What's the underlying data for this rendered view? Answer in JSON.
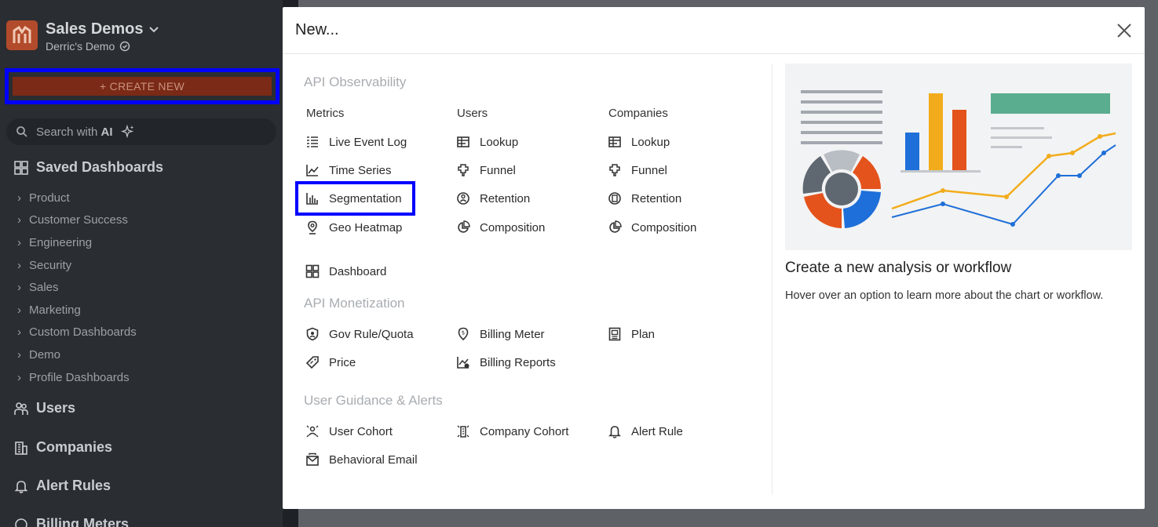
{
  "sidebar": {
    "org_name": "Sales Demos",
    "org_sub": "Derric's Demo",
    "create_label": "+ CREATE NEW",
    "search_label": "Search with",
    "search_ai": "AI",
    "saved_dashboards": "Saved Dashboards",
    "dashboards": [
      "Product",
      "Customer Success",
      "Engineering",
      "Security",
      "Sales",
      "Marketing",
      "Custom Dashboards",
      "Demo",
      "Profile Dashboards"
    ],
    "users": "Users",
    "companies": "Companies",
    "alert_rules": "Alert Rules",
    "billing_meters": "Billing Meters"
  },
  "modal": {
    "title": "New...",
    "api_observability": "API Observability",
    "col_metrics": "Metrics",
    "col_users": "Users",
    "col_companies": "Companies",
    "metrics": [
      "Live Event Log",
      "Time Series",
      "Segmentation",
      "Geo Heatmap"
    ],
    "users": [
      "Lookup",
      "Funnel",
      "Retention",
      "Composition"
    ],
    "companies": [
      "Lookup",
      "Funnel",
      "Retention",
      "Composition"
    ],
    "dashboard": "Dashboard",
    "api_monetization": "API Monetization",
    "gov_rule": "Gov Rule/Quota",
    "billing_meter": "Billing Meter",
    "plan": "Plan",
    "price": "Price",
    "billing_reports": "Billing Reports",
    "user_guidance": "User Guidance & Alerts",
    "user_cohort": "User Cohort",
    "company_cohort": "Company Cohort",
    "alert_rule": "Alert Rule",
    "behavioral_email": "Behavioral Email",
    "preview_title": "Create a new analysis or workflow",
    "preview_desc": "Hover over an option to learn more about the chart or workflow."
  },
  "colors": {
    "accent_orange": "#e4531c",
    "accent_yellow": "#f2ac1b",
    "accent_blue": "#1e6fd9",
    "accent_green": "#5aad8e",
    "highlight": "#0000ff"
  }
}
